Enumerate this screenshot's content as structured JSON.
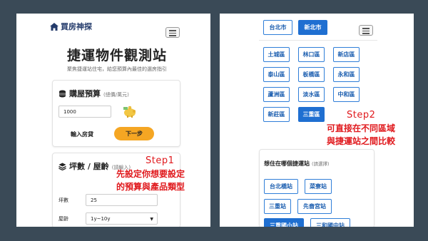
{
  "left": {
    "brand": "買房神探",
    "page_title": "捷運物件觀測站",
    "page_subtitle": "聚焦捷運站住宅，給您預算內最佳的選房指引",
    "budget": {
      "heading": "購屋預算",
      "unit": "(總價/萬元)",
      "input_value": "1000",
      "enter_button": "輸入房貸",
      "next_button": "下一步"
    },
    "area_age": {
      "heading": "坪數 / 屋齡",
      "unit": "(請輸入)",
      "area_label": "坪數",
      "area_value": "25",
      "age_label": "屋齡",
      "age_value": "1y~10y"
    },
    "annotation": {
      "step": "Step1",
      "line1": "先設定你想要設定",
      "line2": "的預算與產品類型"
    }
  },
  "right": {
    "top_cities": [
      "台北市",
      "新北市"
    ],
    "districts": [
      [
        "土城區",
        "林口區",
        "新店區"
      ],
      [
        "泰山區",
        "板橋區",
        "永和區"
      ],
      [
        "蘆洲區",
        "淡水區",
        "中和區"
      ],
      [
        "新莊區",
        "三重區"
      ]
    ],
    "station_card": {
      "title": "想住在哪個捷運站",
      "unit": "(請選擇)",
      "stations": [
        [
          "台北橋站",
          "菜寮站"
        ],
        [
          "三重站",
          "先嗇宮站"
        ],
        [
          "三重國小站",
          "三和國中站"
        ]
      ]
    },
    "annotation": {
      "step": "Step2",
      "line1": "可直接在不同區域",
      "line2": "與捷運站之間比較"
    }
  },
  "colors": {
    "background": "#3a4a57",
    "accent_blue": "#1f6fd1",
    "accent_orange": "#f5a623",
    "annotation_red": "#e0191d"
  }
}
